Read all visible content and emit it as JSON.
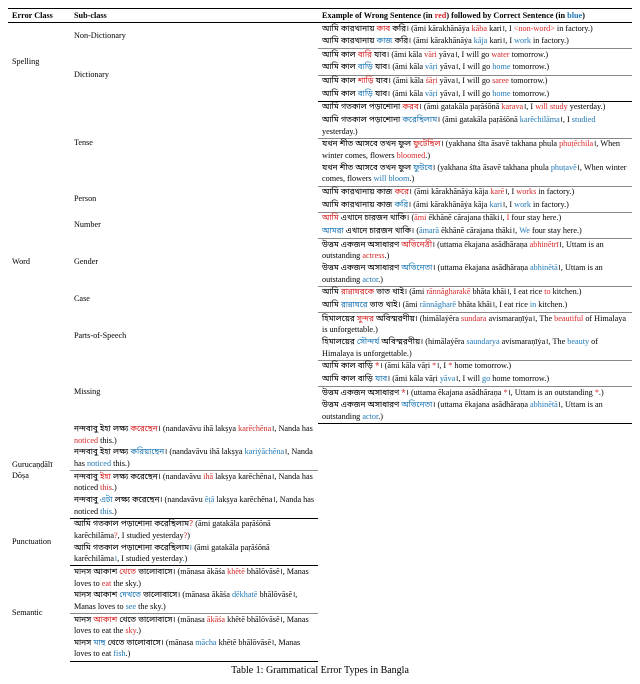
{
  "headers": {
    "c1": "Error Class",
    "c2": "Sub-class",
    "c3": "Example of Wrong Sentence (in ",
    "c3r": "red",
    "c3m": ") followed by Correct Sentence (in ",
    "c3b": "blue",
    "c3e": ")"
  },
  "rows": [
    {
      "ec": "Spelling",
      "sc": "Non-Dictionary",
      "wb": "আমি কারখানায় ",
      "wr": "কাব",
      "wb2": " করি।",
      "wrom": "(āmi kārakhānāẏa ",
      "wromr": "kāba",
      "wrom2": " kari।, I ",
      "wromr2": "<non-word>",
      "wrom3": " in factory.)",
      "cb": "আমি কারখানায় ",
      "cblue": "কাজ",
      "cb2": " করি।",
      "crom": "(āmi kārakhānāẏa ",
      "cromb": "kāja",
      "crom2": " kari।, I ",
      "cromb2": "work",
      "crom3": " in factory.)",
      "sep": "thin"
    },
    {
      "sc": "Dictionary",
      "wb": "আমি কাল ",
      "wr": "বারি",
      "wb2": " যাব।",
      "wrom": "(āmi kāla ",
      "wromr": "vāri",
      "wrom2": " yāva।, I will go ",
      "wromr2": "water",
      "wrom3": " tomorrow.)",
      "cb": "আমি কাল ",
      "cblue": "বাড়ি",
      "cb2": " যাব।",
      "crom": "(āmi kāla ",
      "cromb": "vāṛi",
      "crom2": " yāva।, I will go ",
      "cromb2": "home",
      "crom3": " tomorrow.)",
      "sep": "thin",
      "rowspan_sc": 2
    },
    {
      "wb": "আমি কাল ",
      "wr": "শাড়ি",
      "wb2": " যাব।",
      "wrom": "(āmi kāla ",
      "wromr": "śāṛi",
      "wrom2": " yāva।, I will go ",
      "wromr2": "saree",
      "wrom3": " tomorrow.)",
      "cb": "আমি কাল ",
      "cblue": "বাড়ি",
      "cb2": " যাব।",
      "crom": "(āmi kāla ",
      "cromb": "vāṛi",
      "crom2": " yāva।, I will go ",
      "cromb2": "home",
      "crom3": " tomorrow.)",
      "sep": "row"
    },
    {
      "ec": "Word",
      "sc": "Tense",
      "wb": "আমি গতকাল পড়াশোনা ",
      "wr": "করব",
      "wb2": "।",
      "wrom": "(āmi gatakāla paṛāśōnā ",
      "wromr": "karava",
      "wrom2": "।, I ",
      "wromr2": "will study",
      "wrom3": " yesterday.)",
      "cb": "আমি গতকাল পড়াশোনা ",
      "cblue": "করেছিলাম",
      "cb2": "।",
      "crom": "(āmi gatakāla paṛāśōnā ",
      "cromb": "karēchilāma",
      "crom2": "।, I ",
      "cromb2": "studied",
      "crom3": " yesterday.)",
      "sep": "thin",
      "rowspan_sc": 2
    },
    {
      "wb": "যখন শীত আসবে তখন ফুল ",
      "wr": "ফুটেছিল",
      "wb2": "।",
      "wrom": "(yakhana śīta āsavē takhana phula ",
      "wromr": "phuṭēchila",
      "wrom2": "।, When winter comes, flowers ",
      "wromr2": "bloomed",
      "wrom3": ".)",
      "cb": "যখন শীত আসবে তখন ফুল ",
      "cblue": "ফুটবে",
      "cb2": "।",
      "crom": "(yakhana śīta āsavē takhana phula ",
      "cromb": "phuṭavē",
      "crom2": "।, When winter comes, flowers ",
      "cromb2": "will bloom",
      "crom3": ".)",
      "sep": "thin"
    },
    {
      "sc": "Person",
      "wb": "আমি কারখানায় কাজ ",
      "wr": "করে",
      "wb2": "।",
      "wrom": "(āmi kārakhānāẏa kāja ",
      "wromr": "karē",
      "wrom2": "।, I ",
      "wromr2": "works",
      "wrom3": " in factory.)",
      "cb": "আমি কারখানায় কাজ ",
      "cblue": "করি",
      "cb2": "।",
      "crom": "(āmi kārakhānāẏa kāja ",
      "cromb": "kari",
      "crom2": "।, I ",
      "cromb2": "work",
      "crom3": " in factory.)",
      "sep": "thin"
    },
    {
      "sc": "Number",
      "wb": "",
      "wr": "আমি",
      "wb2": " এখানে চারজন থাকি।",
      "wrom": "(",
      "wromr": "āmi",
      "wrom2": " ēkhānē cārajana thāki।, ",
      "wromr2": "I",
      "wrom3": " four stay here.)",
      "cb": "",
      "cblue": "আমরা",
      "cb2": " এখানে চারজন থাকি।",
      "crom": "(",
      "cromb": "āmarā",
      "crom2": " ēkhānē cārajana thāki।, ",
      "cromb2": "We",
      "crom3": " four stay here.)",
      "sep": "thin"
    },
    {
      "sc": "Gender",
      "wb": "উত্তম একজন অসাধারণ ",
      "wr": "অভিনেত্রী",
      "wb2": "।",
      "wrom": "(uttama ēkajana asādhāraṇa ",
      "wromr": "abhinētrī",
      "wrom2": "।, Uttam is an outstanding ",
      "wromr2": "actress",
      "wrom3": ".)",
      "cb": "উত্তম একজন অসাধারণ ",
      "cblue": "অভিনেতা",
      "cb2": "।",
      "crom": "(uttama ēkajana asādhāraṇa ",
      "cromb": "abhinētā",
      "crom2": "।, Uttam is an outstanding ",
      "cromb2": "actor",
      "crom3": ".)",
      "sep": "thin"
    },
    {
      "sc": "Case",
      "wb": "আমি ",
      "wr": "রান্নাঘরকে",
      "wb2": " ভাত খাই।",
      "wrom": "(āmi ",
      "wromr": "rānnāgharakē",
      "wrom2": " bhāta khāi।, I eat rice ",
      "wromr2": "to",
      "wrom3": " kitchen.)",
      "cb": "আমি ",
      "cblue": "রান্নাঘরে",
      "cb2": " ভাত খাই।",
      "crom": "(āmi ",
      "cromb": "rānnāgharē",
      "crom2": " bhāta khāi।, I eat rice ",
      "cromb2": "in",
      "crom3": " kitchen.)",
      "sep": "thin"
    },
    {
      "sc": "Parts-of-Speech",
      "wb": "হিমালয়ের ",
      "wr": "সুন্দর",
      "wb2": " অবিস্মরণীয়।",
      "wrom": "(himālaẏēra ",
      "wromr": "sundara",
      "wrom2": " avismaraṇīẏa।, The ",
      "wromr2": "beautiful",
      "wrom3": " of Himalaya is unforgettable.)",
      "cb": "হিমালয়ের ",
      "cblue": "সৌন্দর্য",
      "cb2": " অবিস্মরণীয়।",
      "crom": "(himālaẏēra ",
      "cromb": "saundarya",
      "crom2": " avismaraṇīẏa।, The ",
      "cromb2": "beauty",
      "crom3": " of Himalaya is unforgettable.)",
      "sep": "thin"
    },
    {
      "sc": "Missing",
      "wb": "আমি কাল বাড়ি ",
      "wr": "*",
      "wb2": "।",
      "wrom": "(āmi kāla vāṛi ",
      "wromr": "*",
      "wrom2": "।, I ",
      "wromr2": "*",
      "wrom3": " home tomorrow.)",
      "cb": "আমি কাল বাড়ি ",
      "cblue": "যাব",
      "cb2": "।",
      "crom": "(āmi kāla vāṛi ",
      "cromb": "yāva",
      "crom2": "।, I will ",
      "cromb2": "go",
      "crom3": " home tomorrow.)",
      "sep": "thin",
      "rowspan_sc": 2
    },
    {
      "wb": "উত্তম একজন অসাধারণ ",
      "wr": "*",
      "wb2": "।",
      "wrom": "(uttama ēkajana asādhāraṇa ",
      "wromr": "*",
      "wrom2": "।, Uttam is an outstanding ",
      "wromr2": "*",
      "wrom3": ".)",
      "cb": "উত্তম একজন অসাধারণ ",
      "cblue": "অভিনেতা",
      "cb2": "।",
      "crom": "(uttama ēkajana asādhāraṇa ",
      "cromb": "abhinētā",
      "crom2": "।, Uttam is an outstanding ",
      "cromb2": "actor",
      "crom3": ".)",
      "sep": "row"
    },
    {
      "ec": "Gurucaṇḍālī Dōṣa",
      "wb": "নন্দবাবু ইহা লক্ষ্য ",
      "wr": "করেছেন",
      "wb2": "।",
      "wrom": "(nandavāvu ihā lakṣya ",
      "wromr": "karēchēna",
      "wrom2": "।, Nanda has ",
      "wromr2": "noticed",
      "wrom3": " this.)",
      "cb": "নন্দবাবু ইহা লক্ষ্য ",
      "cblue": "করিয়াছেন",
      "cb2": "।",
      "crom": "(nandavāvu ihā lakṣya ",
      "cromb": "kariẏāchēna",
      "crom2": "।, Nanda has ",
      "cromb2": "noticed",
      "crom3": " this.)",
      "sep": "thin",
      "rowspan_ec": 2
    },
    {
      "wb": "নন্দবাবু ",
      "wr": "ইহা",
      "wb2": " লক্ষ্য করেছেন।",
      "wrom": "(nandavāvu ",
      "wromr": "ihā",
      "wrom2": " lakṣya karēchēna।, Nanda has noticed ",
      "wromr2": "this",
      "wrom3": ".)",
      "cb": "নন্দবাবু ",
      "cblue": "এটা",
      "cb2": " লক্ষ্য করেছেন।",
      "crom": "(nandavāvu ",
      "cromb": "ēṭā",
      "crom2": " lakṣya karēchēna।, Nanda has noticed ",
      "cromb2": "this",
      "crom3": ".)",
      "sep": "row"
    },
    {
      "ec": "Punctuation",
      "wb": "আমি গতকাল পড়াশোনা করেছিলাম",
      "wr": "?",
      "wb2": "",
      "wrom": "(āmi gatakāla paṛāśōnā karēchilāma",
      "wromr": "?",
      "wrom2": ", I studied yesterday",
      "wromr2": "?",
      "wrom3": ")",
      "cb": "আমি গতকাল পড়াশোনা করেছিলাম",
      "cblue": "।",
      "cb2": "",
      "crom": "(āmi gatakāla paṛāśōnā karēchilāma",
      "cromb": "।",
      "crom2": ", I studied yesterday",
      "cromb2": ".",
      "crom3": ")",
      "sep": "row"
    },
    {
      "ec": "Semantic",
      "wb": "মানস আকাশ ",
      "wr": "খেতে",
      "wb2": " ভালোবাসে।",
      "wrom": "(mānasa ākāśa ",
      "wromr": "khētē",
      "wrom2": " bhālōvāsē।, Manas loves to ",
      "wromr2": "eat",
      "wrom3": " the sky.)",
      "cb": "মানস আকাশ ",
      "cblue": "দেখতে",
      "cb2": " ভালোবাসে।",
      "crom": "(mānasa ākāśa ",
      "cromb": "dēkhatē",
      "crom2": " bhālōvāsē।, Manas loves to ",
      "cromb2": "see",
      "crom3": " the sky.)",
      "sep": "thin",
      "rowspan_ec": 2
    },
    {
      "wb": "মানস ",
      "wr": "আকাশ",
      "wb2": " খেতে ভালোবাসে।",
      "wrom": "(mānasa ",
      "wromr": "ākāśa",
      "wrom2": " khētē bhālōvāsē।, Manas loves to eat the ",
      "wromr2": "sky",
      "wrom3": ".)",
      "cb": "মানস ",
      "cblue": "মাছ",
      "cb2": " খেতে ভালোবাসে।",
      "crom": "(mānasa ",
      "cromb": "mācha",
      "crom2": " khētē bhālōvāsē।, Manas loves to eat ",
      "cromb2": "fish",
      "crom3": ".)",
      "sep": "row"
    }
  ],
  "caption": "Table 1: Grammatical Error Types in Bangla"
}
